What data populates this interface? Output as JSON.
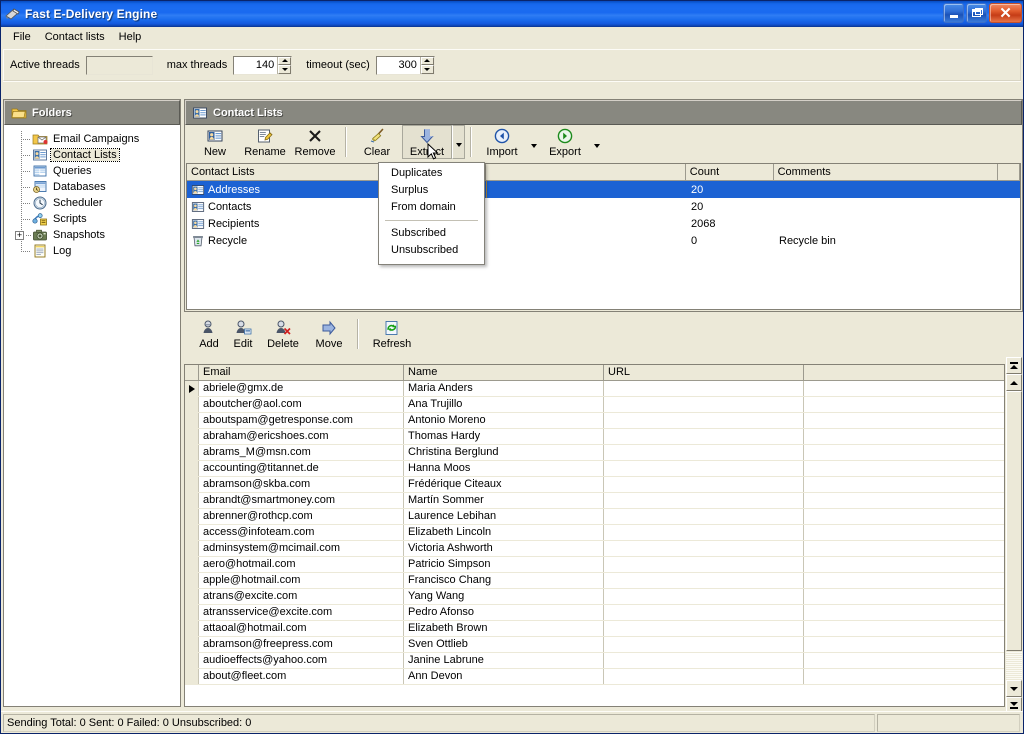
{
  "window": {
    "title": "Fast E-Delivery Engine",
    "icon": "app-icon",
    "buttons": {
      "minimize": "minimize",
      "maximize": "maximize",
      "close": "close"
    }
  },
  "menubar": {
    "items": [
      "File",
      "Contact lists",
      "Help"
    ]
  },
  "threads_toolbar": {
    "active_threads_label": "Active threads",
    "active_threads_value": "",
    "max_threads_label": "max threads",
    "max_threads_value": "140",
    "timeout_label": "timeout (sec)",
    "timeout_value": "300"
  },
  "folders_panel": {
    "title": "Folders",
    "items": [
      {
        "label": "Email Campaigns",
        "icon": "email-campaigns-icon",
        "selected": false,
        "expandable": false
      },
      {
        "label": "Contact Lists",
        "icon": "contact-lists-icon",
        "selected": true,
        "expandable": false
      },
      {
        "label": "Queries",
        "icon": "queries-icon",
        "selected": false,
        "expandable": false
      },
      {
        "label": "Databases",
        "icon": "databases-icon",
        "selected": false,
        "expandable": false
      },
      {
        "label": "Scheduler",
        "icon": "scheduler-icon",
        "selected": false,
        "expandable": false
      },
      {
        "label": "Scripts",
        "icon": "scripts-icon",
        "selected": false,
        "expandable": false
      },
      {
        "label": "Snapshots",
        "icon": "snapshots-icon",
        "selected": false,
        "expandable": true
      },
      {
        "label": "Log",
        "icon": "log-icon",
        "selected": false,
        "expandable": false
      }
    ]
  },
  "lists_panel": {
    "title": "Contact Lists",
    "toolbar": [
      {
        "label": "New",
        "icon": "new-list-icon",
        "split": false
      },
      {
        "label": "Rename",
        "icon": "rename-icon",
        "split": false
      },
      {
        "label": "Remove",
        "icon": "remove-x-icon",
        "split": false
      },
      {
        "label": "Clear",
        "icon": "broom-icon",
        "split": false
      },
      {
        "label": "Extract",
        "icon": "extract-down-arrow-icon",
        "split": true
      },
      {
        "label": "Import",
        "icon": "import-left-arrow-icon",
        "split": true
      },
      {
        "label": "Export",
        "icon": "export-right-arrow-icon",
        "split": true
      }
    ],
    "columns": [
      "Contact Lists",
      "",
      "Count",
      "Comments"
    ],
    "rows": [
      {
        "name": "Addresses",
        "icon": "contact-list-icon",
        "count": "20",
        "comments": "",
        "selected": true
      },
      {
        "name": "Contacts",
        "icon": "contact-list-icon",
        "count": "20",
        "comments": "",
        "selected": false
      },
      {
        "name": "Recipients",
        "icon": "contact-list-icon",
        "count": "2068",
        "comments": "",
        "selected": false
      },
      {
        "name": "Recycle",
        "icon": "recycle-bin-icon",
        "count": "0",
        "comments": "Recycle bin",
        "selected": false
      }
    ]
  },
  "extract_menu": {
    "visible": true,
    "items": [
      "Duplicates",
      "Surplus",
      "From domain"
    ],
    "items2": [
      "Subscribed",
      "Unsubscribed"
    ]
  },
  "contacts_toolbar": [
    {
      "label": "Add",
      "icon": "add-user-icon"
    },
    {
      "label": "Edit",
      "icon": "edit-user-icon"
    },
    {
      "label": "Delete",
      "icon": "delete-user-icon"
    },
    {
      "label": "Move",
      "icon": "move-arrow-icon"
    },
    {
      "label": "Refresh",
      "icon": "refresh-icon"
    }
  ],
  "data_grid": {
    "columns": [
      "Email",
      "Name",
      "URL"
    ],
    "rows": [
      {
        "email": "abriele@gmx.de",
        "name": "Maria Anders",
        "url": "",
        "current": true
      },
      {
        "email": "aboutcher@aol.com",
        "name": "Ana Trujillo",
        "url": "",
        "current": false
      },
      {
        "email": "aboutspam@getresponse.com",
        "name": "Antonio Moreno",
        "url": "",
        "current": false
      },
      {
        "email": "abraham@ericshoes.com",
        "name": "Thomas Hardy",
        "url": "",
        "current": false
      },
      {
        "email": "abrams_M@msn.com",
        "name": "Christina Berglund",
        "url": "",
        "current": false
      },
      {
        "email": "accounting@titannet.de",
        "name": "Hanna Moos",
        "url": "",
        "current": false
      },
      {
        "email": "abramson@skba.com",
        "name": "Frédérique Citeaux",
        "url": "",
        "current": false
      },
      {
        "email": "abrandt@smartmoney.com",
        "name": "Martín Sommer",
        "url": "",
        "current": false
      },
      {
        "email": "abrenner@rothcp.com",
        "name": "Laurence Lebihan",
        "url": "",
        "current": false
      },
      {
        "email": "access@infoteam.com",
        "name": "Elizabeth Lincoln",
        "url": "",
        "current": false
      },
      {
        "email": "adminsystem@mcimail.com",
        "name": "Victoria Ashworth",
        "url": "",
        "current": false
      },
      {
        "email": "aero@hotmail.com",
        "name": "Patricio Simpson",
        "url": "",
        "current": false
      },
      {
        "email": "apple@hotmail.com",
        "name": "Francisco Chang",
        "url": "",
        "current": false
      },
      {
        "email": "atrans@excite.com",
        "name": "Yang Wang",
        "url": "",
        "current": false
      },
      {
        "email": "atransservice@excite.com",
        "name": "Pedro Afonso",
        "url": "",
        "current": false
      },
      {
        "email": "attaoal@hotmail.com",
        "name": "Elizabeth Brown",
        "url": "",
        "current": false
      },
      {
        "email": "abramson@freepress.com",
        "name": "Sven Ottlieb",
        "url": "",
        "current": false
      },
      {
        "email": "audioeffects@yahoo.com",
        "name": "Janine Labrune",
        "url": "",
        "current": false
      },
      {
        "email": "about@fleet.com",
        "name": "Ann Devon",
        "url": "",
        "current": false
      }
    ]
  },
  "statusbar": {
    "text": "Sending  Total: 0  Sent: 0  Failed: 0  Unsubscribed: 0",
    "right_text": ""
  },
  "colors": {
    "selection": "#1c62d3",
    "titlebar": "#1b6cf0",
    "panel_header": "#888880",
    "face": "#ece9d8"
  }
}
